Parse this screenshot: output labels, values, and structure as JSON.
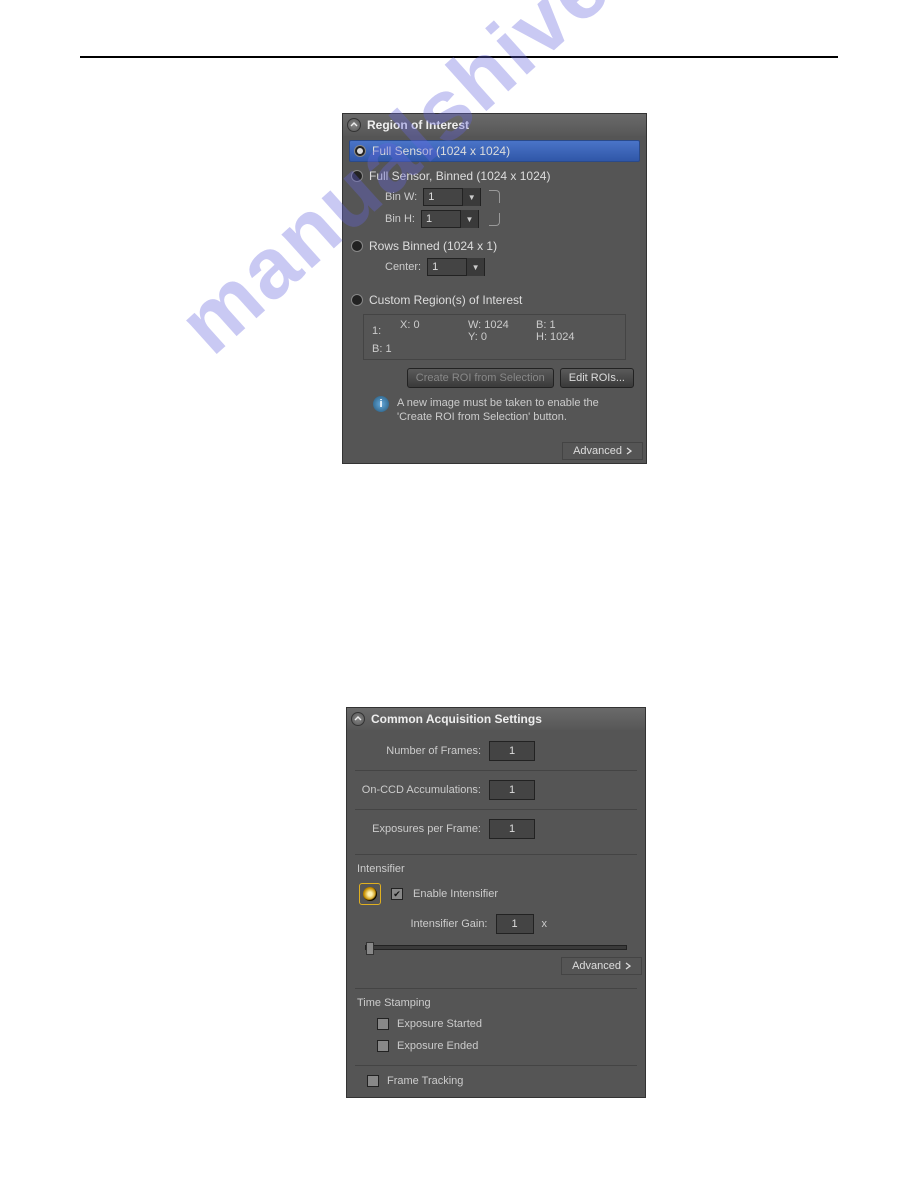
{
  "watermark": "manualshive.com",
  "roi": {
    "title": "Region of Interest",
    "options": [
      {
        "label": "Full Sensor (1024 x 1024)"
      },
      {
        "label": "Full Sensor, Binned (1024 x 1024)"
      },
      {
        "label": "Rows Binned (1024 x 1)"
      },
      {
        "label": "Custom Region(s) of Interest"
      }
    ],
    "bin": {
      "w_label": "Bin W:",
      "w_value": "1",
      "h_label": "Bin H:",
      "h_value": "1"
    },
    "center": {
      "label": "Center:",
      "value": "1"
    },
    "custom": {
      "index": "1:",
      "x": "X: 0",
      "y": "Y: 0",
      "w": "W: 1024",
      "h": "H: 1024",
      "b1": "B: 1",
      "b2": "B: 1"
    },
    "buttons": {
      "create": "Create ROI from Selection",
      "edit": "Edit ROIs..."
    },
    "info_text": "A new image must be taken to enable the 'Create ROI from Selection' button.",
    "advanced_label": "Advanced"
  },
  "acq": {
    "title": "Common Acquisition Settings",
    "frames": {
      "label": "Number of Frames:",
      "value": "1"
    },
    "accum": {
      "label": "On-CCD Accumulations:",
      "value": "1"
    },
    "exposures": {
      "label": "Exposures per Frame:",
      "value": "1"
    },
    "intensifier": {
      "group_label": "Intensifier",
      "enable_label": "Enable Intensifier",
      "gain_label": "Intensifier Gain:",
      "gain_value": "1",
      "gain_unit": "x",
      "advanced_label": "Advanced"
    },
    "timestamp": {
      "group_label": "Time Stamping",
      "started_label": "Exposure Started",
      "ended_label": "Exposure Ended"
    },
    "frame_tracking_label": "Frame Tracking"
  }
}
